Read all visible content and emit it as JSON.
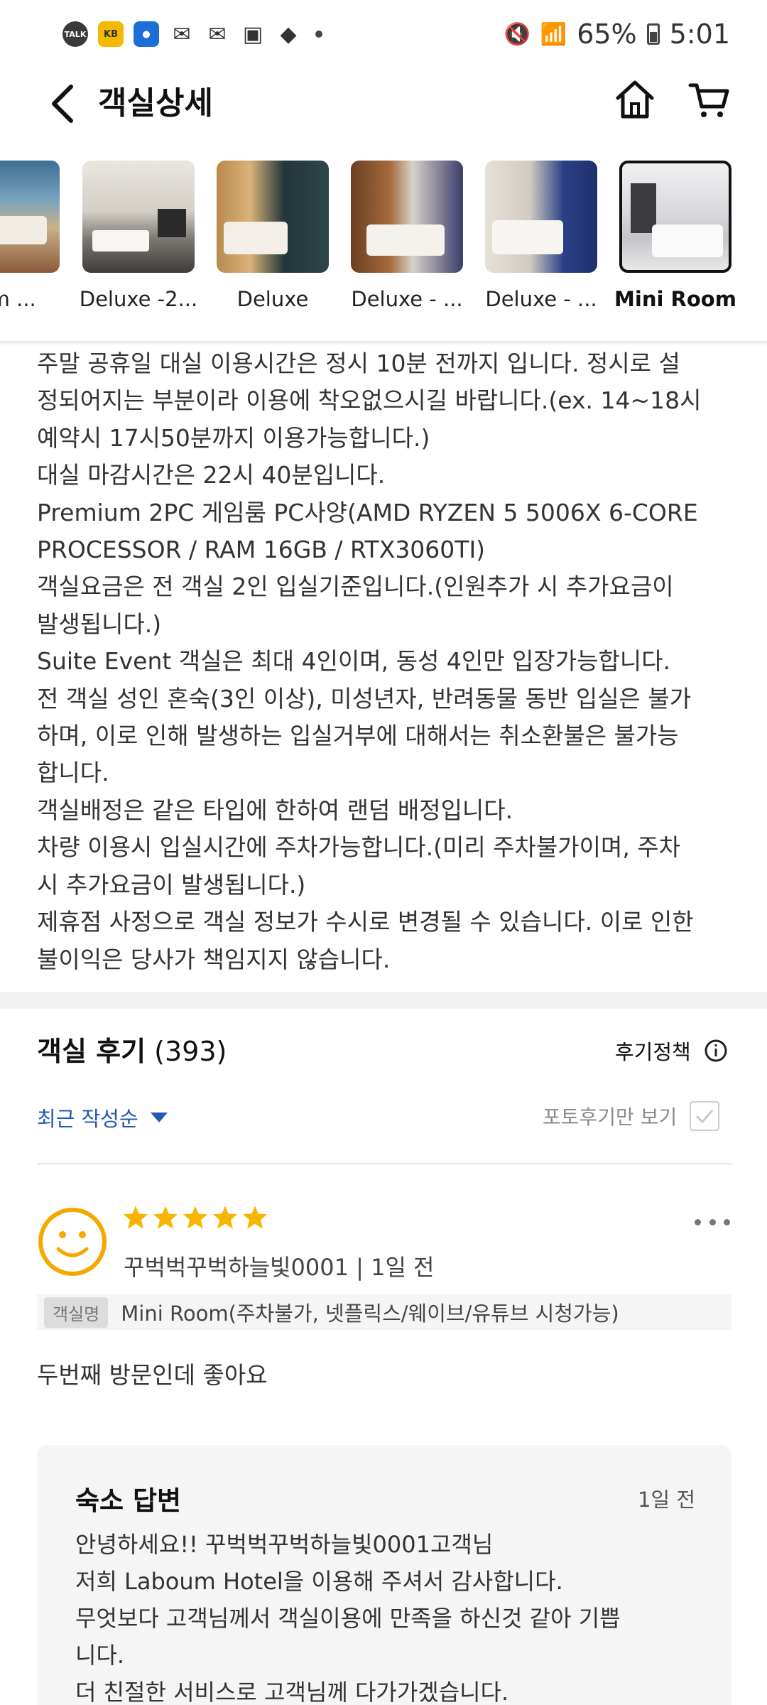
{
  "status_bar": {
    "talk_label": "TALK",
    "kb_label": "KB",
    "battery": "65%",
    "time": "5:01"
  },
  "header": {
    "title": "객실상세"
  },
  "rooms": [
    {
      "label": "ium ...",
      "active": false
    },
    {
      "label": "Deluxe -2...",
      "active": false
    },
    {
      "label": "Deluxe",
      "active": false
    },
    {
      "label": "Deluxe - ...",
      "active": false
    },
    {
      "label": "Deluxe - ...",
      "active": false
    },
    {
      "label": "Mini Room",
      "active": true
    }
  ],
  "notice": [
    "주말 공휴일 대실 이용시간은 정시 10분 전까지 입니다. 정시로 설",
    "정되어지는 부분이라 이용에 착오없으시길 바랍니다.(ex. 14~18시",
    "예약시 17시50분까지 이용가능합니다.)",
    "대실 마감시간은 22시 40분입니다.",
    "Premium 2PC 게임룸 PC사양(AMD RYZEN 5 5006X 6-CORE",
    "PROCESSOR / RAM 16GB / RTX3060TI)",
    "객실요금은 전 객실 2인 입실기준입니다.(인원추가 시 추가요금이",
    "발생됩니다.)",
    "Suite Event 객실은 최대 4인이며, 동성 4인만 입장가능합니다.",
    "전 객실 성인 혼숙(3인 이상), 미성년자, 반려동물 동반 입실은 불가",
    "하며, 이로 인해 발생하는 입실거부에 대해서는 취소환불은 불가능",
    "합니다.",
    "객실배정은 같은 타입에 한하여 랜덤 배정입니다.",
    "차량 이용시 입실시간에 주차가능합니다.(미리 주차불가이며, 주차",
    "시 추가요금이 발생됩니다.)",
    "제휴점 사정으로 객실 정보가 수시로 변경될 수 있습니다. 이로 인한",
    "불이익은 당사가 책임지지 않습니다."
  ],
  "reviews": {
    "title": "객실 후기",
    "count": "(393)",
    "policy_label": "후기정책",
    "sort_label": "최근 작성순",
    "photo_only_label": "포토후기만 보기"
  },
  "review": {
    "rating": 5,
    "reviewer": "꾸벅벅꾸벅하늘빛0001 | 1일 전",
    "room_tag": "객실명",
    "room_name": "Mini Room(주차불가, 넷플릭스/웨이브/유튜브 시청가능)",
    "text": "두번째 방문인데 좋아요"
  },
  "reply": {
    "title": "숙소 답변",
    "date": "1일 전",
    "lines": [
      "안녕하세요!! 꾸벅벅꾸벅하늘빛0001고객님",
      "저희 Laboum Hotel을 이용해 주셔서 감사합니다.",
      "무엇보다 고객님께서 객실이용에 만족을 하신것 같아 기쁩",
      "니다.",
      "더 친절한 서비스로 고객님께 다가가겠습니다."
    ]
  },
  "colors": {
    "accent_blue": "#2259b6",
    "star": "#f7b500"
  }
}
